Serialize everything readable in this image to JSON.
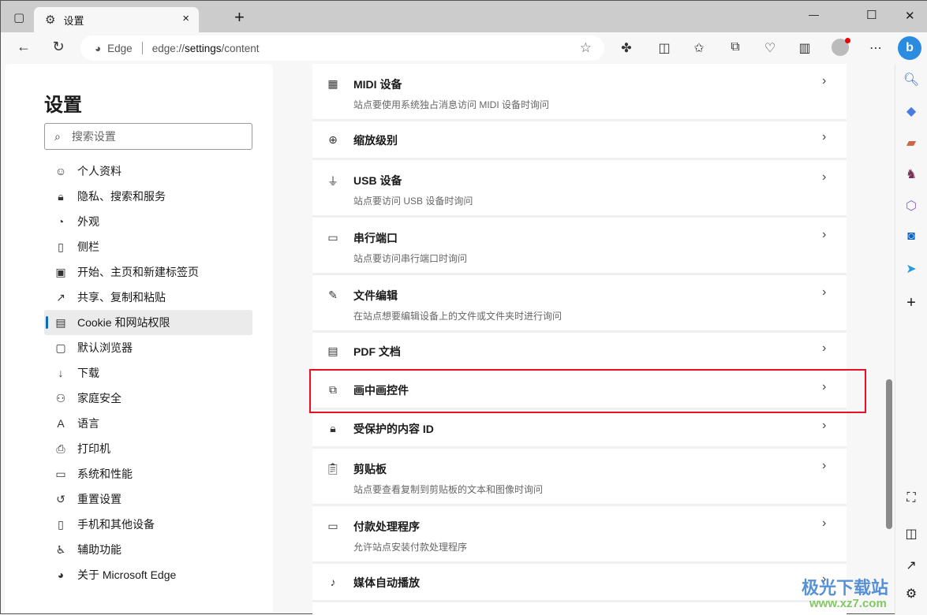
{
  "tab": {
    "title": "设置",
    "close": "×",
    "new": "+"
  },
  "window": {
    "minimize": "—",
    "maximize": "☐",
    "close": "✕"
  },
  "address": {
    "site": "Edge",
    "url_prefix": "edge://",
    "url_main": "settings",
    "url_suffix": "/content"
  },
  "settings": {
    "title": "设置",
    "search_placeholder": "搜索设置"
  },
  "nav": [
    {
      "label": "个人资料",
      "icon": "profile-icon",
      "g": "☺"
    },
    {
      "label": "隐私、搜索和服务",
      "icon": "lock-icon",
      "g": "🔒︎"
    },
    {
      "label": "外观",
      "icon": "palette-icon",
      "g": "◔"
    },
    {
      "label": "侧栏",
      "icon": "sidebar-icon",
      "g": "▯"
    },
    {
      "label": "开始、主页和新建标签页",
      "icon": "home-icon",
      "g": "▣"
    },
    {
      "label": "共享、复制和粘贴",
      "icon": "share-icon",
      "g": "↗"
    },
    {
      "label": "Cookie 和网站权限",
      "icon": "cookie-icon",
      "g": "▤",
      "active": true
    },
    {
      "label": "默认浏览器",
      "icon": "browser-icon",
      "g": "▢"
    },
    {
      "label": "下载",
      "icon": "download-icon",
      "g": "↓"
    },
    {
      "label": "家庭安全",
      "icon": "family-icon",
      "g": "⚇"
    },
    {
      "label": "语言",
      "icon": "language-icon",
      "g": "A"
    },
    {
      "label": "打印机",
      "icon": "printer-icon",
      "g": "⎙"
    },
    {
      "label": "系统和性能",
      "icon": "laptop-icon",
      "g": "▭"
    },
    {
      "label": "重置设置",
      "icon": "reset-icon",
      "g": "↺"
    },
    {
      "label": "手机和其他设备",
      "icon": "phone-icon",
      "g": "▯"
    },
    {
      "label": "辅助功能",
      "icon": "accessibility-icon",
      "g": "♿︎"
    },
    {
      "label": "关于 Microsoft Edge",
      "icon": "edge-icon",
      "g": "◕"
    }
  ],
  "rows": [
    {
      "title": "MIDI 设备",
      "desc": "站点要使用系统独占消息访问 MIDI 设备时询问",
      "icon": "midi-icon",
      "g": "▦"
    },
    {
      "title": "缩放级别",
      "icon": "zoom-icon",
      "g": "⊕"
    },
    {
      "title": "USB 设备",
      "desc": "站点要访问 USB 设备时询问",
      "icon": "usb-icon",
      "g": "⏚"
    },
    {
      "title": "串行端口",
      "desc": "站点要访问串行端口时询问",
      "icon": "serial-port-icon",
      "g": "▭"
    },
    {
      "title": "文件编辑",
      "desc": "在站点想要编辑设备上的文件或文件夹时进行询问",
      "icon": "file-edit-icon",
      "g": "✎"
    },
    {
      "title": "PDF 文档",
      "icon": "pdf-icon",
      "g": "▤"
    },
    {
      "title": "画中画控件",
      "icon": "picture-in-picture-icon",
      "g": "⧉",
      "highlight": true
    },
    {
      "title": "受保护的内容 ID",
      "icon": "lock-icon",
      "g": "🔒︎"
    },
    {
      "title": "剪贴板",
      "desc": "站点要查看复制到剪贴板的文本和图像时询问",
      "icon": "clipboard-icon",
      "g": "📋︎"
    },
    {
      "title": "付款处理程序",
      "desc": "允许站点安装付款处理程序",
      "icon": "card-icon",
      "g": "▭"
    },
    {
      "title": "媒体自动播放",
      "icon": "music-icon",
      "g": "♪"
    }
  ],
  "highlight_color": "#e81123",
  "watermark": {
    "name": "极光下载站",
    "url": "www.xz7.com"
  }
}
